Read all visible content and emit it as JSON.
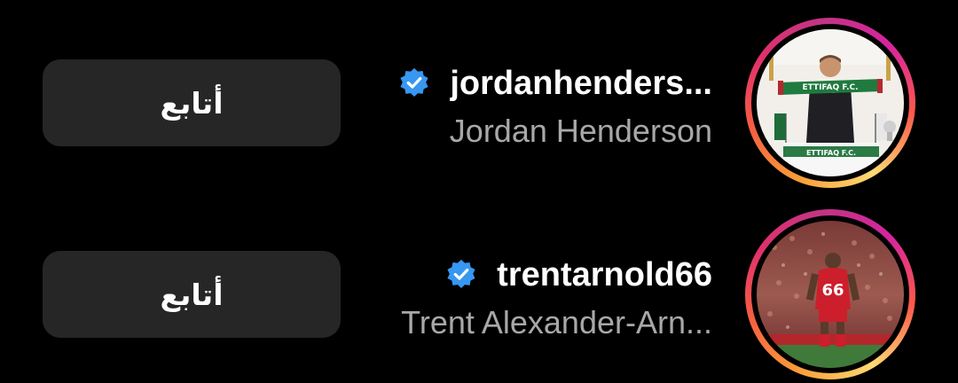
{
  "suggestions": [
    {
      "username": "jordanhenders...",
      "full_name": "Jordan Henderson",
      "verified": true,
      "follow_label": "أتابع",
      "avatar_desc": "man-holding-ettifaq-scarf",
      "scarf_text": "ETTIFAQ F.C."
    },
    {
      "username": "trentarnold66",
      "full_name": "Trent Alexander-Arn...",
      "verified": true,
      "follow_label": "أتابع",
      "avatar_desc": "player-number-66-red-kit",
      "shirt_number": "66"
    }
  ],
  "colors": {
    "background": "#000000",
    "button": "#262626",
    "primary_text": "#ffffff",
    "secondary_text": "#a8a8a8",
    "verified_blue": "#3897f0"
  },
  "icons": {
    "verified": "verified-badge-icon"
  }
}
